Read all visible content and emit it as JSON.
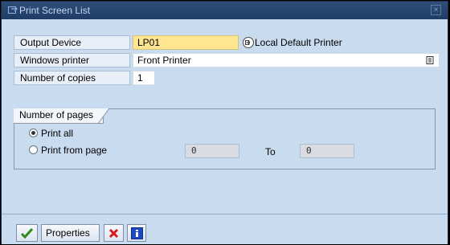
{
  "window": {
    "title": "Print Screen List"
  },
  "fields": {
    "output_device": {
      "label": "Output Device",
      "value": "LP01",
      "description": "Local Default Printer"
    },
    "windows_printer": {
      "label": "Windows printer",
      "value": "Front Printer"
    },
    "copies": {
      "label": "Number of copies",
      "value": "1"
    }
  },
  "pages": {
    "group_title": "Number of pages",
    "print_all_label": "Print all",
    "print_from_label": "Print from page",
    "from_value": "0",
    "to_label": "To",
    "to_value": "0"
  },
  "toolbar": {
    "properties_label": "Properties"
  },
  "colors": {
    "window_bg": "#c9dbee",
    "titlebar": "#1f3c65",
    "highlight_field": "#ffe58f"
  }
}
